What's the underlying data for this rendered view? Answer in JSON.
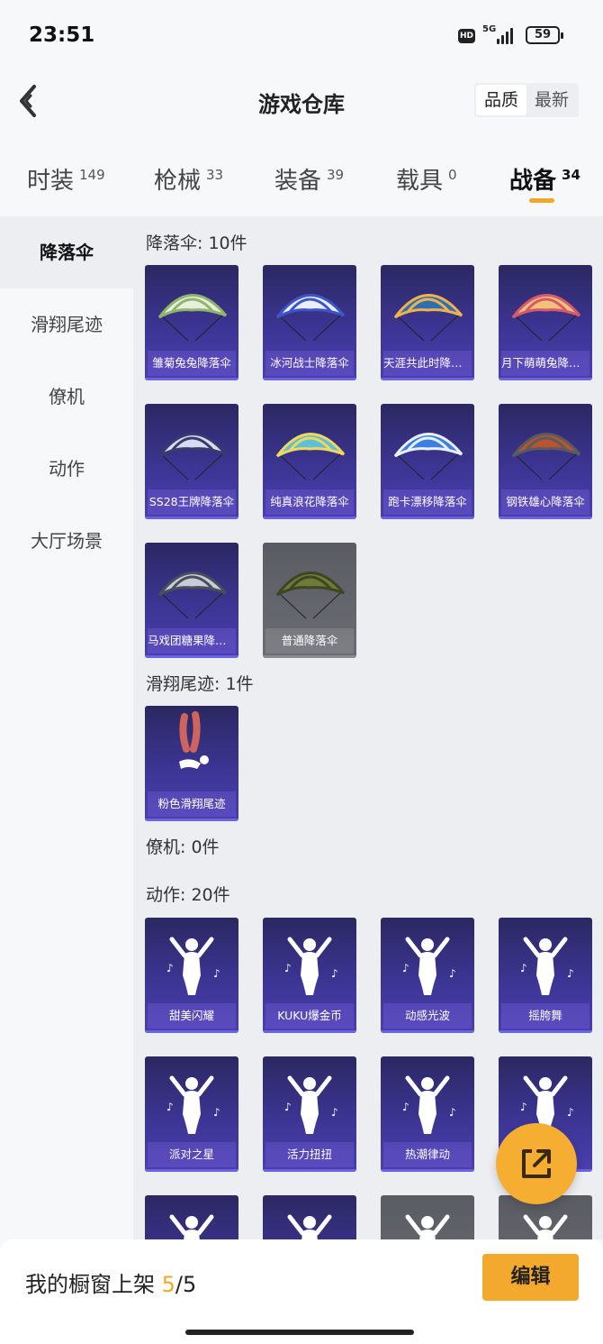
{
  "status": {
    "time": "23:51",
    "hd": "HD",
    "network": "5G",
    "battery": "59"
  },
  "header": {
    "title": "游戏仓库",
    "sort_quality": "品质",
    "sort_newest": "最新"
  },
  "tabs": [
    {
      "label": "时装",
      "count": "149"
    },
    {
      "label": "枪械",
      "count": "33"
    },
    {
      "label": "装备",
      "count": "39"
    },
    {
      "label": "载具",
      "count": "0"
    },
    {
      "label": "战备",
      "count": "34"
    }
  ],
  "sidebar": [
    "降落伞",
    "滑翔尾迹",
    "僚机",
    "动作",
    "大厅场景"
  ],
  "sections": {
    "parachute": "降落伞: 10件",
    "trail": "滑翔尾迹: 1件",
    "wingman": "僚机: 0件",
    "emote": "动作: 20件"
  },
  "parachutes": [
    "雏菊兔兔降落伞",
    "冰河战士降落伞",
    "天涯共此时降落伞",
    "月下萌萌兔降落伞",
    "SS28王牌降落伞",
    "纯真浪花降落伞",
    "跑卡漂移降落伞",
    "钢铁雄心降落伞",
    "马戏团糖果降落伞",
    "普通降落伞"
  ],
  "trails": [
    "粉色滑翔尾迹"
  ],
  "emotes": [
    "甜美闪耀",
    "KUKU爆金币",
    "动感光波",
    "摇胯舞",
    "派对之星",
    "活力扭扭",
    "热潮律动",
    "",
    "",
    "",
    "",
    ""
  ],
  "bottom": {
    "label": "我的橱窗上架 ",
    "current": "5",
    "total": "/5",
    "edit": "编辑"
  },
  "colors": {
    "accent": "#f0a826",
    "card_purple": "#3d3594",
    "card_gray": "#6b6d74"
  },
  "icons": {
    "back": "back-chevron-icon",
    "share": "share-external-icon"
  }
}
